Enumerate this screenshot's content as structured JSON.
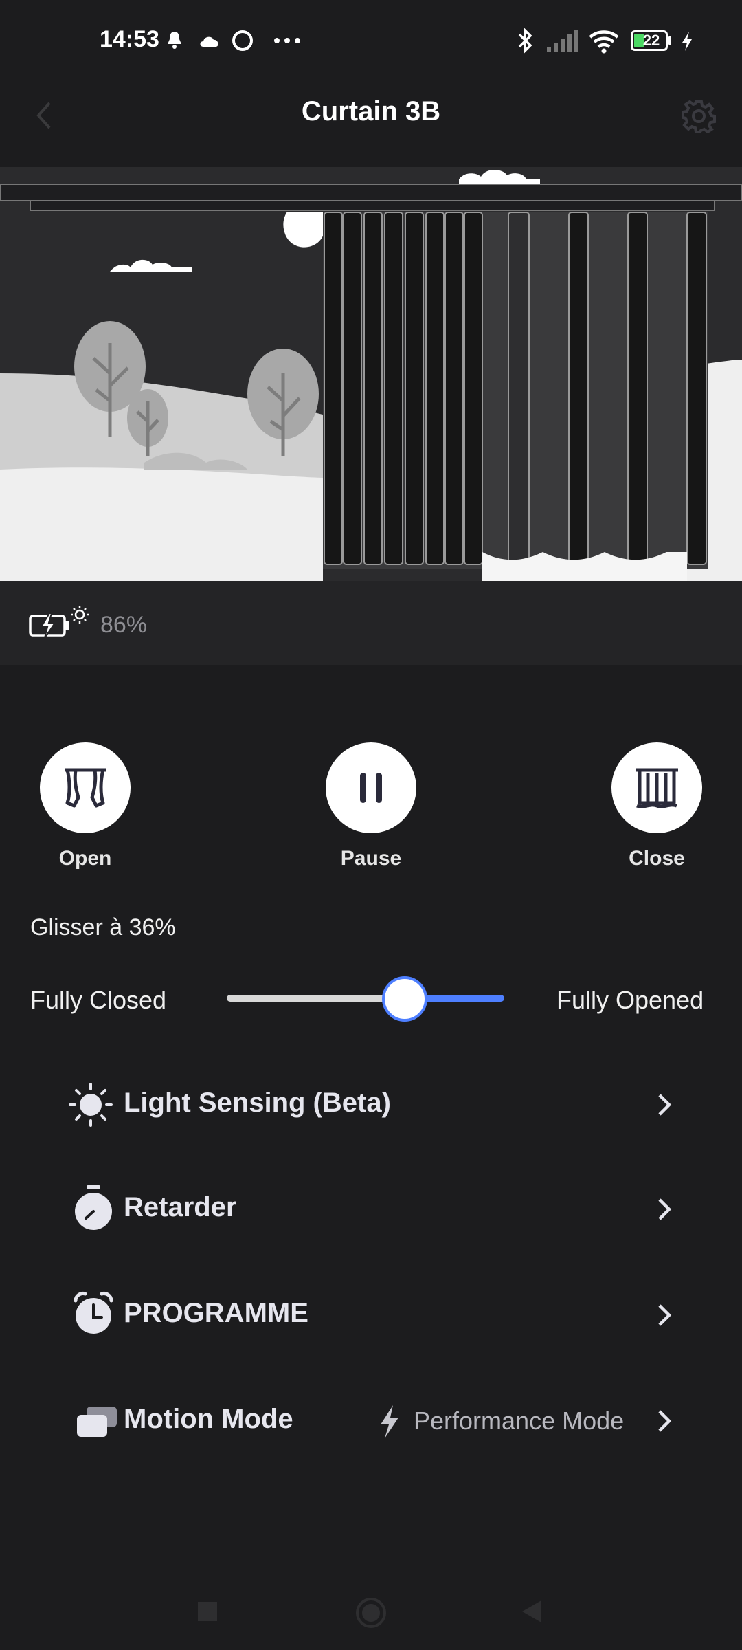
{
  "status_bar": {
    "time": "14:53",
    "battery_level": "22",
    "icons": [
      "bell-icon",
      "cloud-icon",
      "circle-icon",
      "more-dots-icon",
      "bluetooth-icon",
      "signal-icon",
      "wifi-icon",
      "battery-icon",
      "charging-bolt-icon"
    ]
  },
  "header": {
    "title": "Curtain 3B",
    "back_icon": "back-chevron-icon",
    "settings_icon": "gear-icon"
  },
  "device": {
    "battery_percent": "86%",
    "battery_icon": "solar-battery-icon"
  },
  "controls": {
    "open_label": "Open",
    "pause_label": "Pause",
    "close_label": "Close"
  },
  "slider": {
    "status_text": "Glisser à 36%",
    "left_label": "Fully Closed",
    "right_label": "Fully Opened",
    "value_percent": 64
  },
  "menu": {
    "items": [
      {
        "label": "Light Sensing (Beta)",
        "icon": "sun-icon",
        "value": ""
      },
      {
        "label": "Retarder",
        "icon": "timer-icon",
        "value": ""
      },
      {
        "label": "PROGRAMME",
        "icon": "alarm-clock-icon",
        "value": ""
      },
      {
        "label": "Motion Mode",
        "icon": "cards-icon",
        "value": "Performance Mode",
        "value_icon": "lightning-icon"
      }
    ]
  },
  "colors": {
    "background": "#1c1c1e",
    "accent": "#4e7fff",
    "muted_text": "#8e8e93"
  }
}
